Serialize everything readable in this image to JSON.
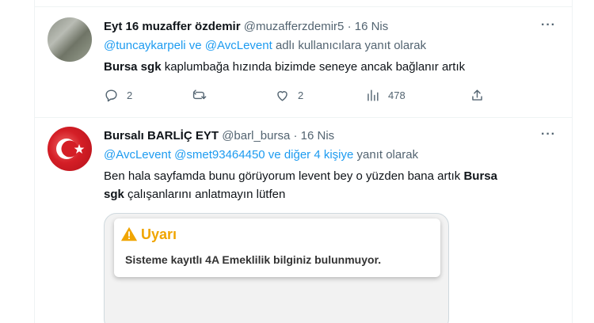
{
  "tweet1": {
    "name": "Eyt 16 muzaffer özdemir",
    "handle": "@muzafferzdemir5",
    "sep": "·",
    "time": "16 Nis",
    "reply_mentions": "@tuncaykarpeli ve @AvcLevent",
    "reply_suffix": "adlı kullanıcılara yanıt olarak",
    "text_bold": "Bursa sgk",
    "text_rest": "kaplumbağa hızında bizimde seneye ancak bağlanır artık",
    "replies": "2",
    "likes": "2",
    "views": "478"
  },
  "tweet2": {
    "name": "Bursalı BARLİÇ EYT",
    "handle": "@barl_bursa",
    "sep": "·",
    "time": "16 Nis",
    "reply_mentions": "@AvcLevent @smet93464450  ve diğer 4 kişiye",
    "reply_suffix": "yanıt olarak",
    "text_part1": "Ben hala sayfamda bunu görüyorum levent bey o yüzden bana artık",
    "text_bold1": "Bursa",
    "text_bold2": "sgk",
    "text_part2": "çalışanlarını anlatmayın lütfen",
    "card": {
      "title": "Uyarı",
      "message": "Sisteme kayıtlı 4A Emeklilik bilginiz bulunmuyor."
    }
  },
  "more_label": "···",
  "colors": {
    "link": "#1d9bf0",
    "muted": "#536471",
    "warning": "#f0a500"
  }
}
